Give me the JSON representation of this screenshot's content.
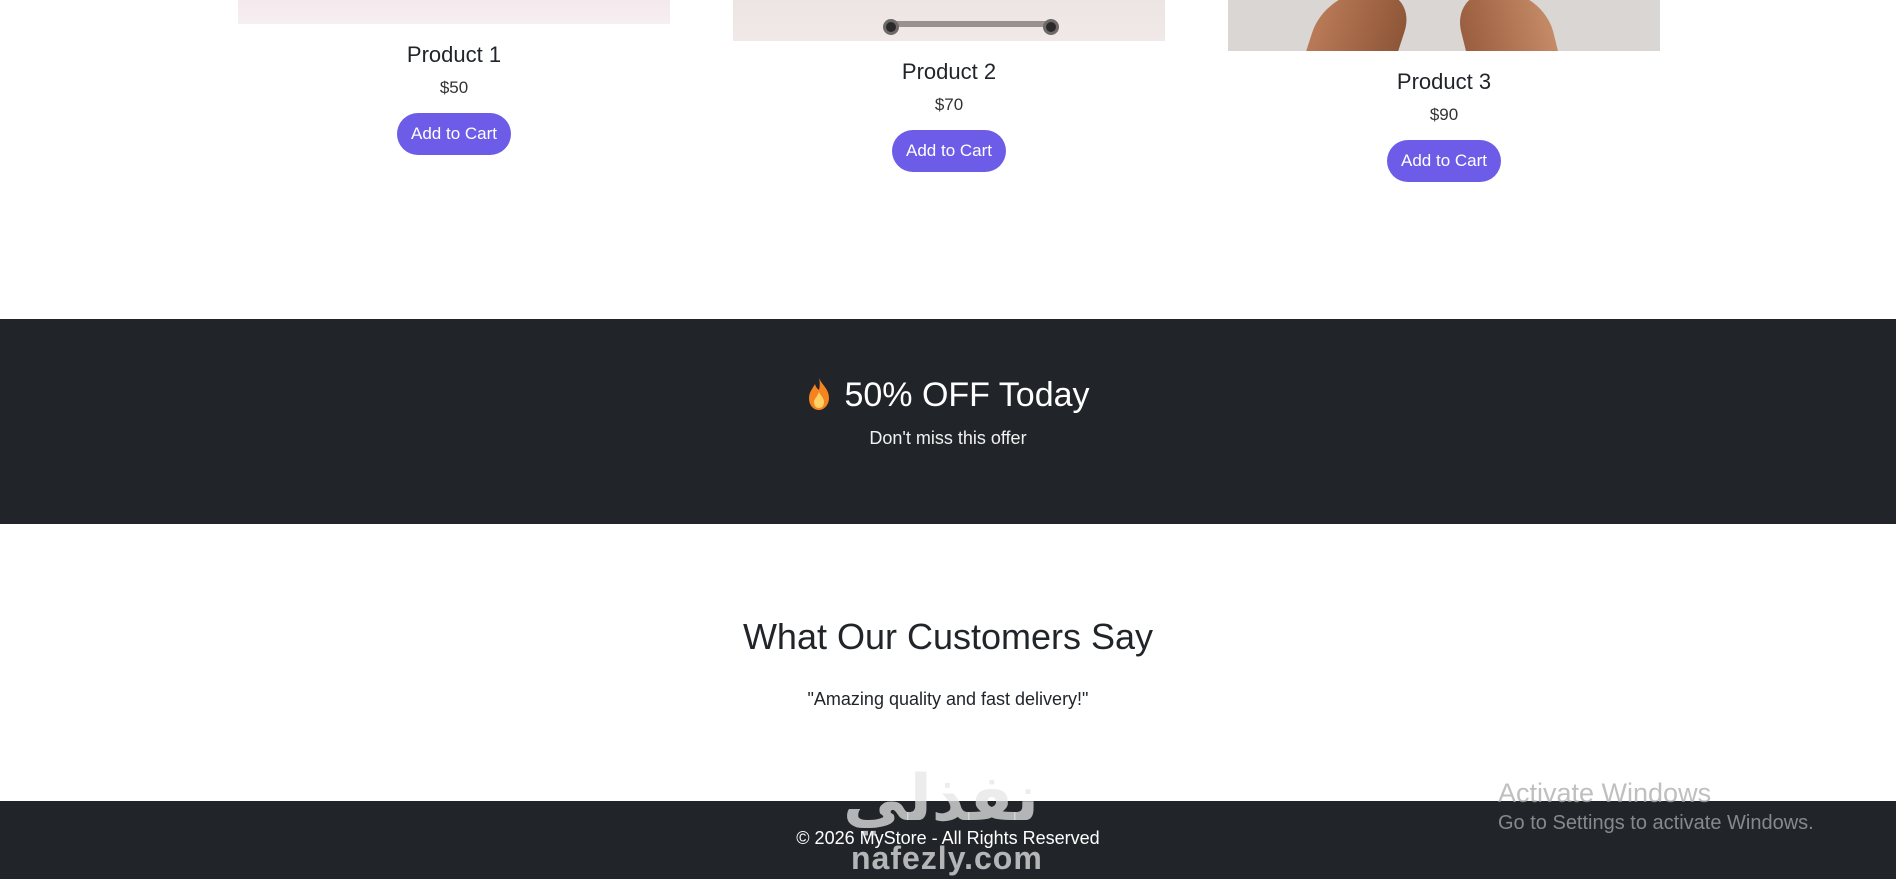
{
  "products": [
    {
      "name": "Product 1",
      "price": "$50",
      "button": "Add to Cart"
    },
    {
      "name": "Product 2",
      "price": "$70",
      "button": "Add to Cart"
    },
    {
      "name": "Product 3",
      "price": "$90",
      "button": "Add to Cart"
    }
  ],
  "promo": {
    "icon": "fire-icon",
    "title": "50% OFF Today",
    "subtitle": "Don't miss this offer"
  },
  "testimonials": {
    "title": "What Our Customers Say",
    "quote": "\"Amazing quality and fast delivery!\""
  },
  "footer": {
    "text": "© 2026 MyStore - All Rights Reserved"
  },
  "watermark": {
    "arabic": "نفذلي",
    "latin": "nafezly.com"
  },
  "windows_notice": {
    "title": "Activate Windows",
    "subtitle": "Go to Settings to activate Windows."
  },
  "colors": {
    "accent": "#6c5ce7",
    "dark": "#212529",
    "background": "#ffffff"
  }
}
